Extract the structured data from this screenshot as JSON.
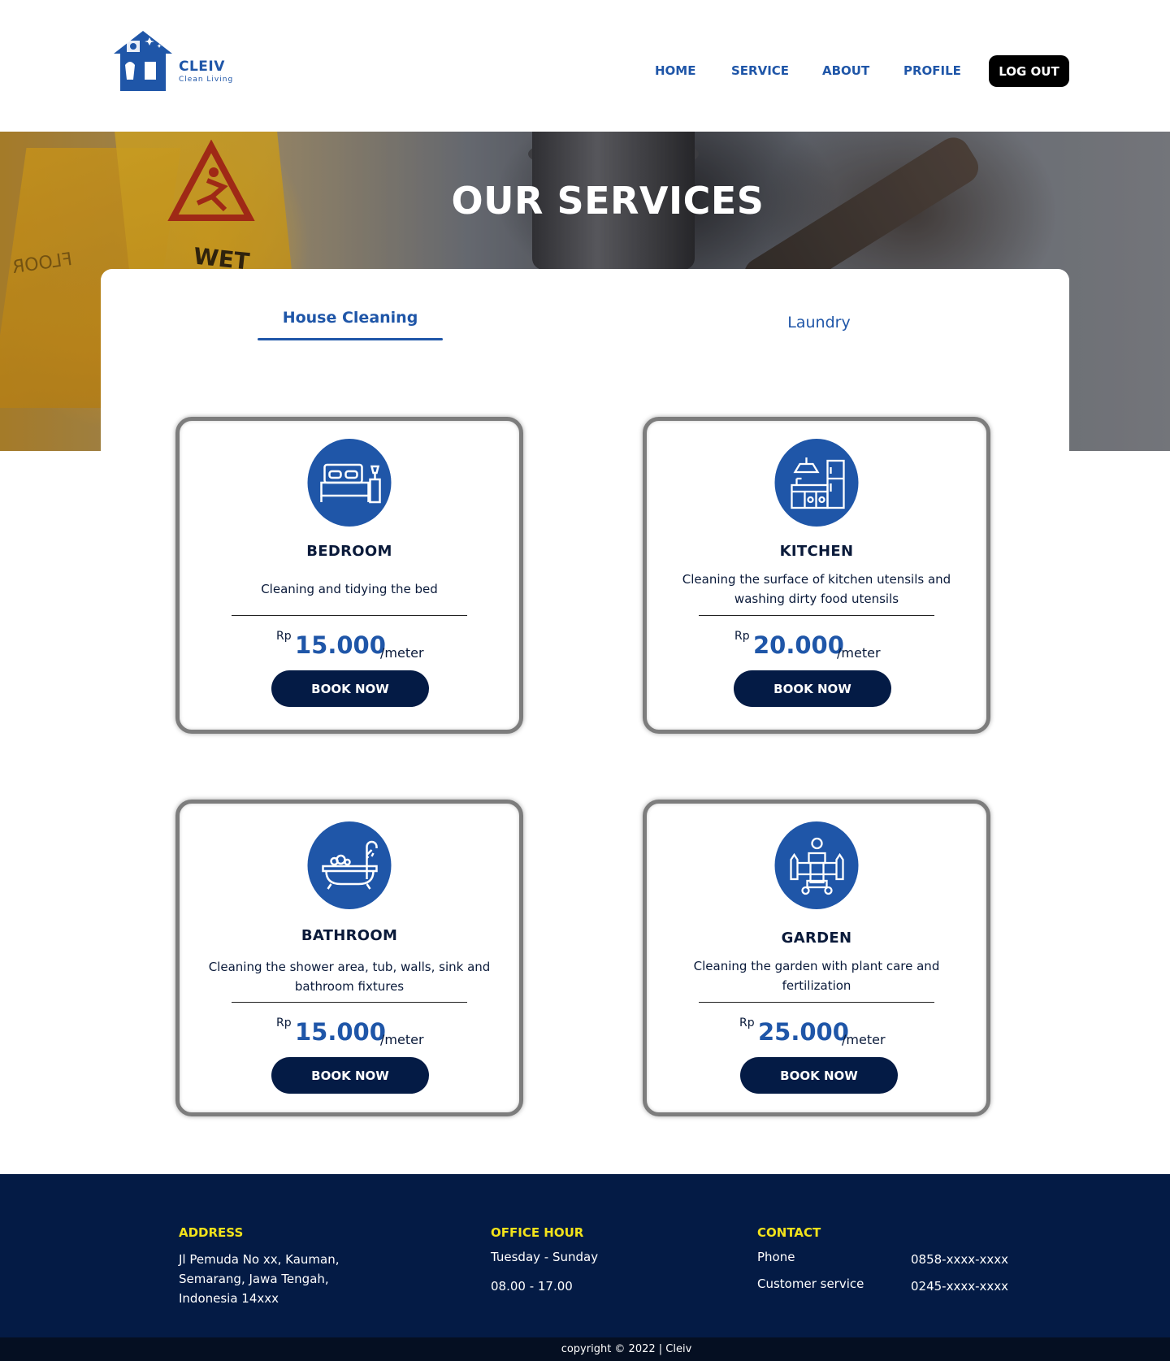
{
  "brand": {
    "name": "CLEIV",
    "tagline": "Clean Living",
    "primary_color": "#1f56a8",
    "dark_color": "#041b45",
    "accent_color": "#f2e21a"
  },
  "nav": {
    "home": "HOME",
    "service": "SERVICE",
    "about": "ABOUT",
    "profile": "PROFILE",
    "logout": "LOG OUT"
  },
  "hero": {
    "title": "OUR SERVICES",
    "sign_wet": "WET",
    "sign_floor": "FLOOR"
  },
  "tabs": {
    "house_cleaning": "House Cleaning",
    "laundry": "Laundry",
    "active": "House Cleaning"
  },
  "services": [
    {
      "title": "BEDROOM",
      "icon": "bed-icon",
      "description": "Cleaning and tidying the bed",
      "currency": "Rp",
      "price": "15.000",
      "unit": "/meter",
      "button": "BOOK NOW"
    },
    {
      "title": "KITCHEN",
      "icon": "kitchen-icon",
      "description": "Cleaning the surface of kitchen utensils and washing dirty food utensils",
      "currency": "Rp",
      "price": "20.000",
      "unit": "/meter",
      "button": "BOOK NOW"
    },
    {
      "title": "BATHROOM",
      "icon": "bathtub-icon",
      "description": "Cleaning the shower area, tub, walls, sink and bathroom fixtures",
      "currency": "Rp",
      "price": "15.000",
      "unit": "/meter",
      "button": "BOOK NOW"
    },
    {
      "title": "GARDEN",
      "icon": "lawn-mower-icon",
      "description": "Cleaning the garden with plant care and fertilization",
      "currency": "Rp",
      "price": "25.000",
      "unit": "/meter",
      "button": "BOOK NOW"
    }
  ],
  "footer": {
    "address_heading": "ADDRESS",
    "address_line1": "Jl Pemuda  No xx, Kauman,",
    "address_line2": "Semarang, Jawa Tengah,",
    "address_line3": "Indonesia 14xxx",
    "office_heading": "OFFICE HOUR",
    "office_days": "Tuesday - Sunday",
    "office_hours": "08.00 - 17.00",
    "contact_heading": "CONTACT",
    "phone_label": "Phone",
    "phone_value": "0858-xxxx-xxxx",
    "cs_label": "Customer service",
    "cs_value": "0245-xxxx-xxxx"
  },
  "copyright": "copyright © 2022 | Cleiv"
}
